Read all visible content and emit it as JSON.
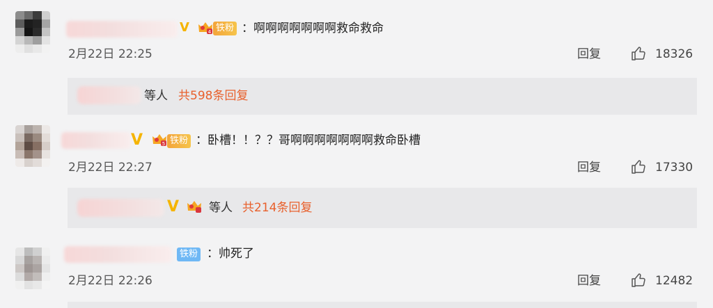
{
  "comments": [
    {
      "text": "啊啊啊啊啊啊啊救命救命",
      "fan_badge": "铁粉",
      "timestamp": "2月22日 22:25",
      "reply_label": "回复",
      "likes": "18326",
      "sub": {
        "etc_label": "等人",
        "count_text": "共598条回复"
      }
    },
    {
      "text": "卧槽！！？？哥啊啊啊啊啊啊啊救命卧槽",
      "fan_badge": "铁粉",
      "timestamp": "2月22日 22:27",
      "reply_label": "回复",
      "likes": "17330",
      "sub": {
        "etc_label": "等人",
        "count_text": "共214条回复"
      }
    },
    {
      "text": "帅死了",
      "fan_badge": "铁粉",
      "timestamp": "2月22日 22:26",
      "reply_label": "回复",
      "likes": "12482"
    }
  ],
  "colors": {
    "background": "#f3f3f4",
    "reply_count": "#e8602c",
    "verified_v": "#f5b400",
    "fan_badge_gold": "#f3a43a",
    "fan_badge_blue": "#6fb8f5"
  }
}
